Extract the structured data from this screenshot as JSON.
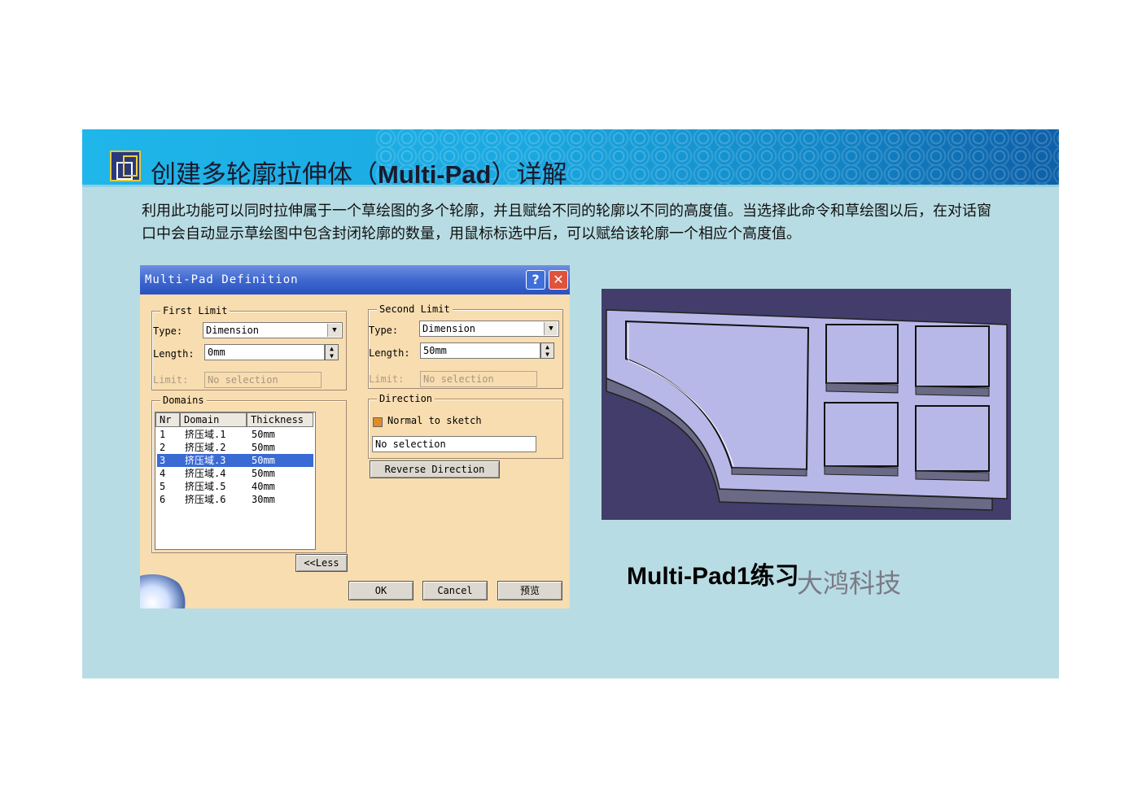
{
  "slide": {
    "title_prefix": "创建多轮廓拉伸体（",
    "title_bold": "Multi-Pad",
    "title_suffix": "）详解",
    "description": "利用此功能可以同时拉伸属于一个草绘图的多个轮廓，并且赋给不同的轮廓以不同的高度值。当选择此命令和草绘图以后，在对话窗口中会自动显示草绘图中包含封闭轮廓的数量，用鼠标标选中后，可以赋给该轮廓一个相应个高度值。",
    "caption": "Multi-Pad1练习",
    "watermark": "大鸿科技",
    "colors": {
      "banner": "#1aa8e0",
      "background": "#b8dce3",
      "dialog": "#f8ddb0",
      "model_bg": "#423d6a",
      "model_face": "#b8b8e8"
    }
  },
  "dialog": {
    "title": "Multi-Pad Definition",
    "help_label": "?",
    "close_label": "✕",
    "first_limit": {
      "group_label": "First Limit",
      "type_label": "Type:",
      "type_value": "Dimension",
      "length_label": "Length:",
      "length_value": "0mm",
      "limit_label": "Limit:",
      "limit_value": "No selection"
    },
    "second_limit": {
      "group_label": "Second Limit",
      "type_label": "Type:",
      "type_value": "Dimension",
      "length_label": "Length:",
      "length_value": "50mm",
      "limit_label": "Limit:",
      "limit_value": "No selection"
    },
    "domains": {
      "group_label": "Domains",
      "headers": [
        "Nr",
        "Domain",
        "Thickness"
      ],
      "rows": [
        {
          "nr": "1",
          "domain": "挤压域.1",
          "thickness": "50mm"
        },
        {
          "nr": "2",
          "domain": "挤压域.2",
          "thickness": "50mm"
        },
        {
          "nr": "3",
          "domain": "挤压域.3",
          "thickness": "50mm"
        },
        {
          "nr": "4",
          "domain": "挤压域.4",
          "thickness": "50mm"
        },
        {
          "nr": "5",
          "domain": "挤压域.5",
          "thickness": "40mm"
        },
        {
          "nr": "6",
          "domain": "挤压域.6",
          "thickness": "30mm"
        }
      ],
      "selected_row": 3
    },
    "direction": {
      "group_label": "Direction",
      "normal_label": "Normal to sketch",
      "normal_checked": true,
      "selection_value": "No selection",
      "reverse_label": "Reverse Direction"
    },
    "less_label": "<<Less",
    "ok_label": "OK",
    "cancel_label": "Cancel",
    "preview_label": "预览"
  }
}
